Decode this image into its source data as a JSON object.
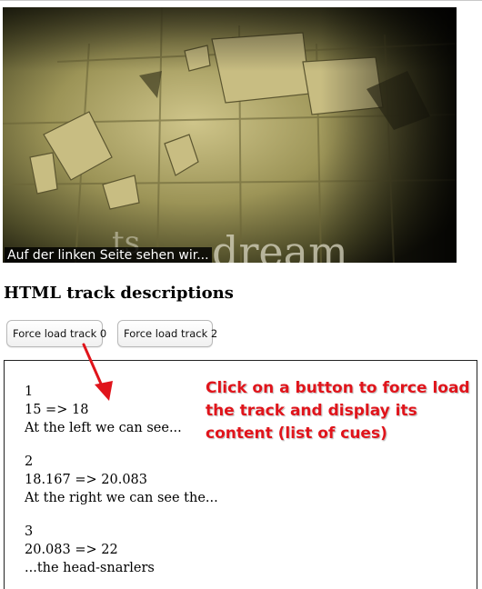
{
  "video": {
    "caption": "Auf der linken Seite sehen wir..."
  },
  "heading": "HTML track descriptions",
  "buttons": {
    "track0": "Force load track 0",
    "track2": "Force load track 2"
  },
  "cues": [
    {
      "index": "1",
      "time": "15 => 18",
      "text": "At the left we can see..."
    },
    {
      "index": "2",
      "time": "18.167 => 20.083",
      "text": "At the right we can see the..."
    },
    {
      "index": "3",
      "time": "20.083 => 22",
      "text": "...the head-snarlers"
    }
  ],
  "annotation": {
    "lines": [
      "Click on a button to force load",
      "the track and display its",
      "content (list of cues)"
    ],
    "color": "#e0141b"
  }
}
